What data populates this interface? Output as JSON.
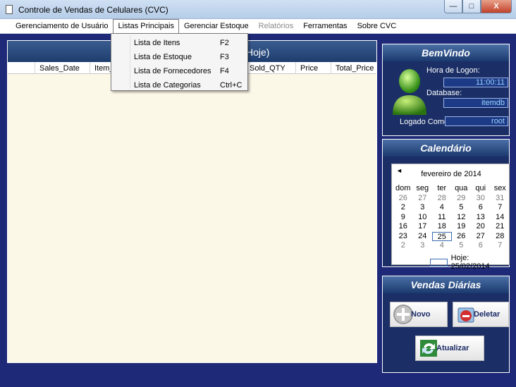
{
  "window": {
    "title": "Controle de Vendas de Celulares (CVC)",
    "min_glyph": "—",
    "max_glyph": "□",
    "close_glyph": "X"
  },
  "menu": {
    "items": [
      {
        "label": "Gerenciamento de Usuário"
      },
      {
        "label": "Listas Principais"
      },
      {
        "label": "Gerenciar Estoque"
      },
      {
        "label": "Relatórios"
      },
      {
        "label": "Ferramentas"
      },
      {
        "label": "Sobre CVC"
      }
    ]
  },
  "dropdown": {
    "items": [
      {
        "label": "Lista de Itens",
        "shortcut": "F2"
      },
      {
        "label": "Lista de Estoque",
        "shortcut": "F3"
      },
      {
        "label": "Lista de Fornecedores",
        "shortcut": "F4"
      },
      {
        "label": "Lista de Categorias",
        "shortcut": "Ctrl+C"
      }
    ]
  },
  "grid": {
    "title": "Hoje)",
    "columns": [
      "Sales_Date",
      "Item_",
      "Sold_QTY",
      "Price",
      "Total_Price"
    ]
  },
  "welcome": {
    "title": "BemVindo",
    "logon_label": "Hora de Logon:",
    "logon_value": "11:00:11",
    "database_label": "Database:",
    "database_value": "itemdb",
    "logged_label": "Logado Como:",
    "logged_value": "root"
  },
  "calendar": {
    "title": "Calendário",
    "nav_prev": "◄",
    "month": "fevereiro de 2014",
    "weekdays": [
      "dom",
      "seg",
      "ter",
      "qua",
      "qui",
      "sex"
    ],
    "weeks": [
      [
        "26",
        "27",
        "28",
        "29",
        "30",
        "31"
      ],
      [
        "2",
        "3",
        "4",
        "5",
        "6",
        "7"
      ],
      [
        "9",
        "10",
        "11",
        "12",
        "13",
        "14"
      ],
      [
        "16",
        "17",
        "18",
        "19",
        "20",
        "21"
      ],
      [
        "23",
        "24",
        "25",
        "26",
        "27",
        "28"
      ],
      [
        "2",
        "3",
        "4",
        "5",
        "6",
        "7"
      ]
    ],
    "today_label": "Hoje: 25/02/2014"
  },
  "sales": {
    "title": "Vendas Diárias",
    "new_label": "Novo",
    "delete_label": "Deletar",
    "refresh_label": "Atualizar"
  },
  "colors": {
    "background": "#1e2a78",
    "panel_header": "#1b3a6e",
    "accent": "#3a6bb0"
  }
}
